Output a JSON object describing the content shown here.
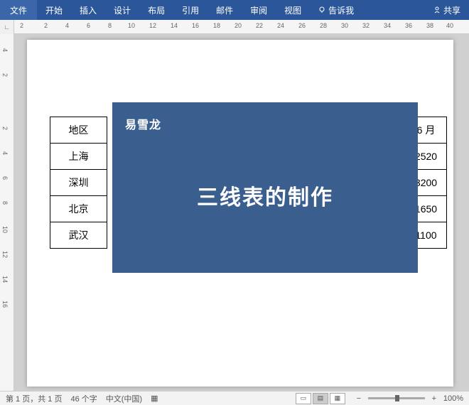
{
  "ribbon": {
    "file": "文件",
    "tabs": [
      "开始",
      "插入",
      "设计",
      "布局",
      "引用",
      "邮件",
      "审阅",
      "视图"
    ],
    "tell": "告诉我",
    "share": "共享"
  },
  "ruler_h": [
    "2",
    "2",
    "4",
    "6",
    "8",
    "10",
    "12",
    "14",
    "16",
    "18",
    "20",
    "22",
    "24",
    "26",
    "28",
    "30",
    "32",
    "34",
    "36",
    "38",
    "40"
  ],
  "ruler_v": [
    "4",
    "2",
    "",
    "2",
    "4",
    "6",
    "8",
    "10",
    "12",
    "14",
    "16"
  ],
  "table": {
    "rows": [
      {
        "a": "地区",
        "b": "6 月"
      },
      {
        "a": "上海",
        "b": "2520"
      },
      {
        "a": "深圳",
        "b": "3200"
      },
      {
        "a": "北京",
        "b": "1650"
      },
      {
        "a": "武汉",
        "b": "1100"
      }
    ]
  },
  "overlay": {
    "brand": "易雪龙",
    "title": "三线表的制作"
  },
  "status": {
    "page": "第 1 页，共 1 页",
    "words": "46 个字",
    "lang": "中文(中国)",
    "zoom_minus": "−",
    "zoom_plus": "+",
    "zoom_pct": "100%"
  }
}
